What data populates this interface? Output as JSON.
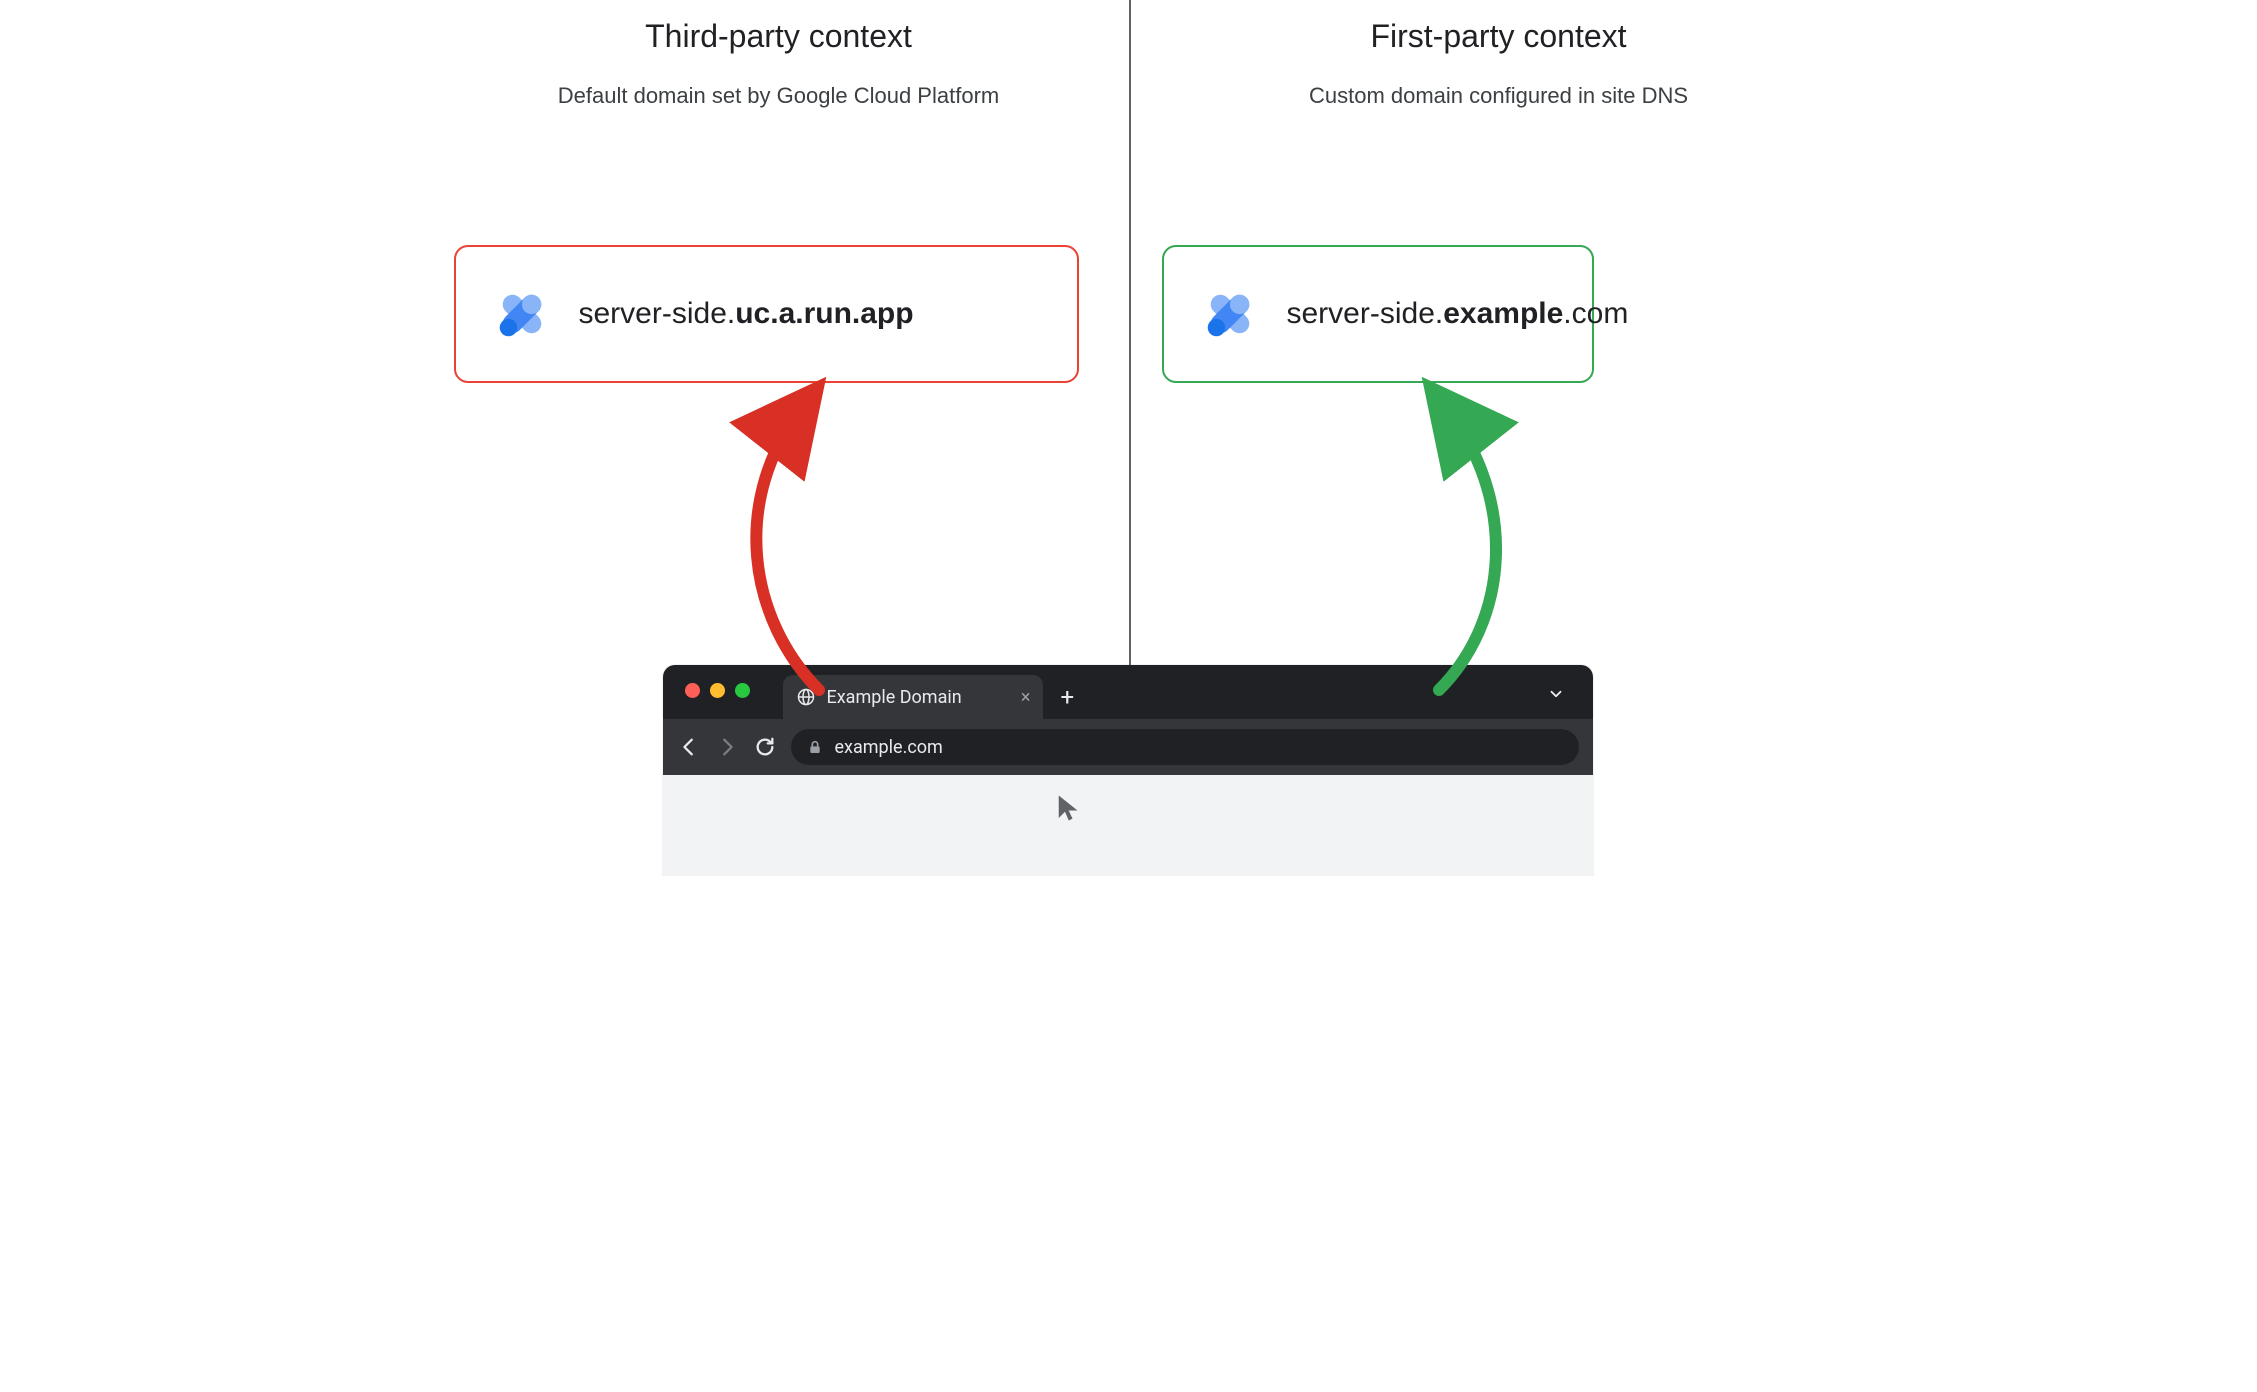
{
  "left": {
    "title": "Third-party context",
    "subtitle": "Default domain set by Google Cloud Platform",
    "domain_prefix": "server-side.",
    "domain_bold": "uc.a.run.app",
    "domain_suffix": "",
    "box_color": "#ea4335",
    "arrow_color": "#d93025"
  },
  "right": {
    "title": "First-party context",
    "subtitle": "Custom domain configured in site DNS",
    "domain_prefix": "server-side.",
    "domain_bold": "example",
    "domain_suffix": ".com",
    "box_color": "#34a853",
    "arrow_color": "#34a853"
  },
  "browser": {
    "tab_title": "Example Domain",
    "url": "example.com",
    "new_tab_glyph": "+",
    "close_glyph": "×"
  },
  "icons": {
    "gtm": "gtm-logo-icon",
    "globe": "globe-favicon-icon",
    "lock": "lock-icon",
    "back": "arrow-left-icon",
    "forward": "arrow-right-icon",
    "reload": "reload-icon",
    "caret": "chevron-down-icon",
    "cursor": "mouse-cursor-icon"
  }
}
